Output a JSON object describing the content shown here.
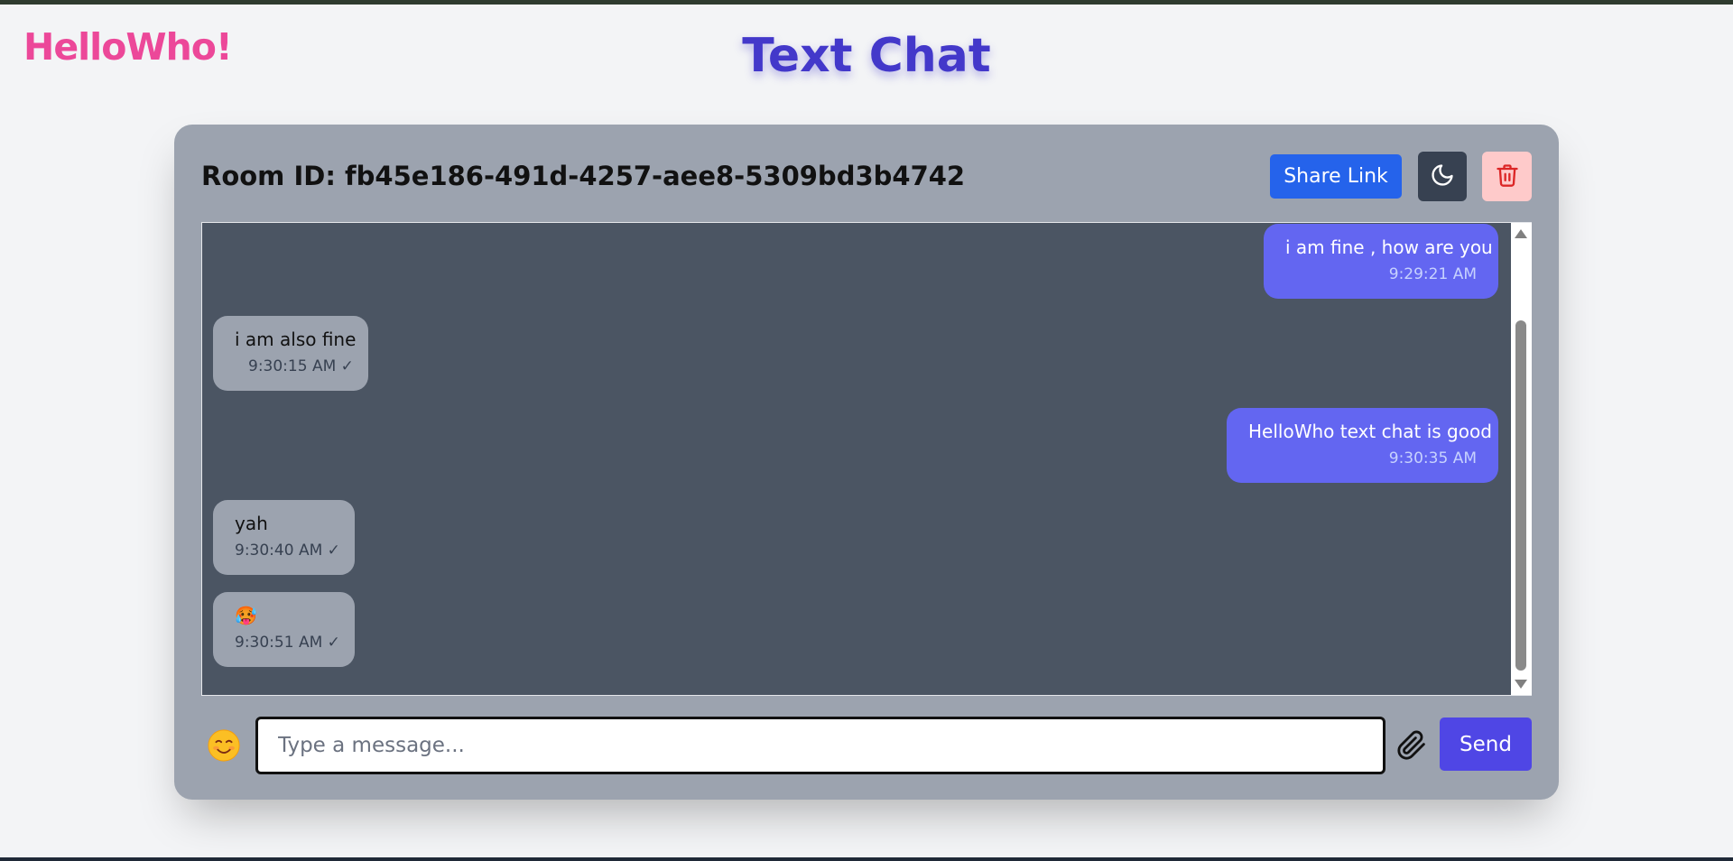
{
  "header": {
    "logo": "HelloWho!",
    "title": "Text Chat"
  },
  "room": {
    "label": "Room ID: fb45e186-491d-4257-aee8-5309bd3b4742",
    "share_label": "Share Link",
    "theme_icon": "moon-icon",
    "delete_icon": "trash-icon"
  },
  "messages": [
    {
      "direction": "out",
      "text": "i am fine , how are you",
      "time": "9:29:21 AM"
    },
    {
      "direction": "in",
      "text": "i am also fine",
      "time": "9:30:15 AM ✓"
    },
    {
      "direction": "out",
      "text": "HelloWho text chat is good",
      "time": "9:30:35 AM"
    },
    {
      "direction": "in",
      "text": "yah",
      "time": "9:30:40 AM ✓"
    },
    {
      "direction": "in",
      "text": "🥵",
      "time": "9:30:51 AM ✓"
    }
  ],
  "composer": {
    "emoji_icon": "smiley-icon",
    "placeholder": "Type a message...",
    "value": "",
    "attach_icon": "paperclip-icon",
    "send_label": "Send"
  },
  "colors": {
    "logo": "#ec4899",
    "title": "#4338ca",
    "card": "#9ca3af",
    "chat_bg": "#4b5563",
    "outgoing_bubble": "#6366f1",
    "incoming_bubble": "#9ca3af",
    "share_button": "#2563eb",
    "send_button": "#4f46e5",
    "delete_button": "#fecaca"
  }
}
